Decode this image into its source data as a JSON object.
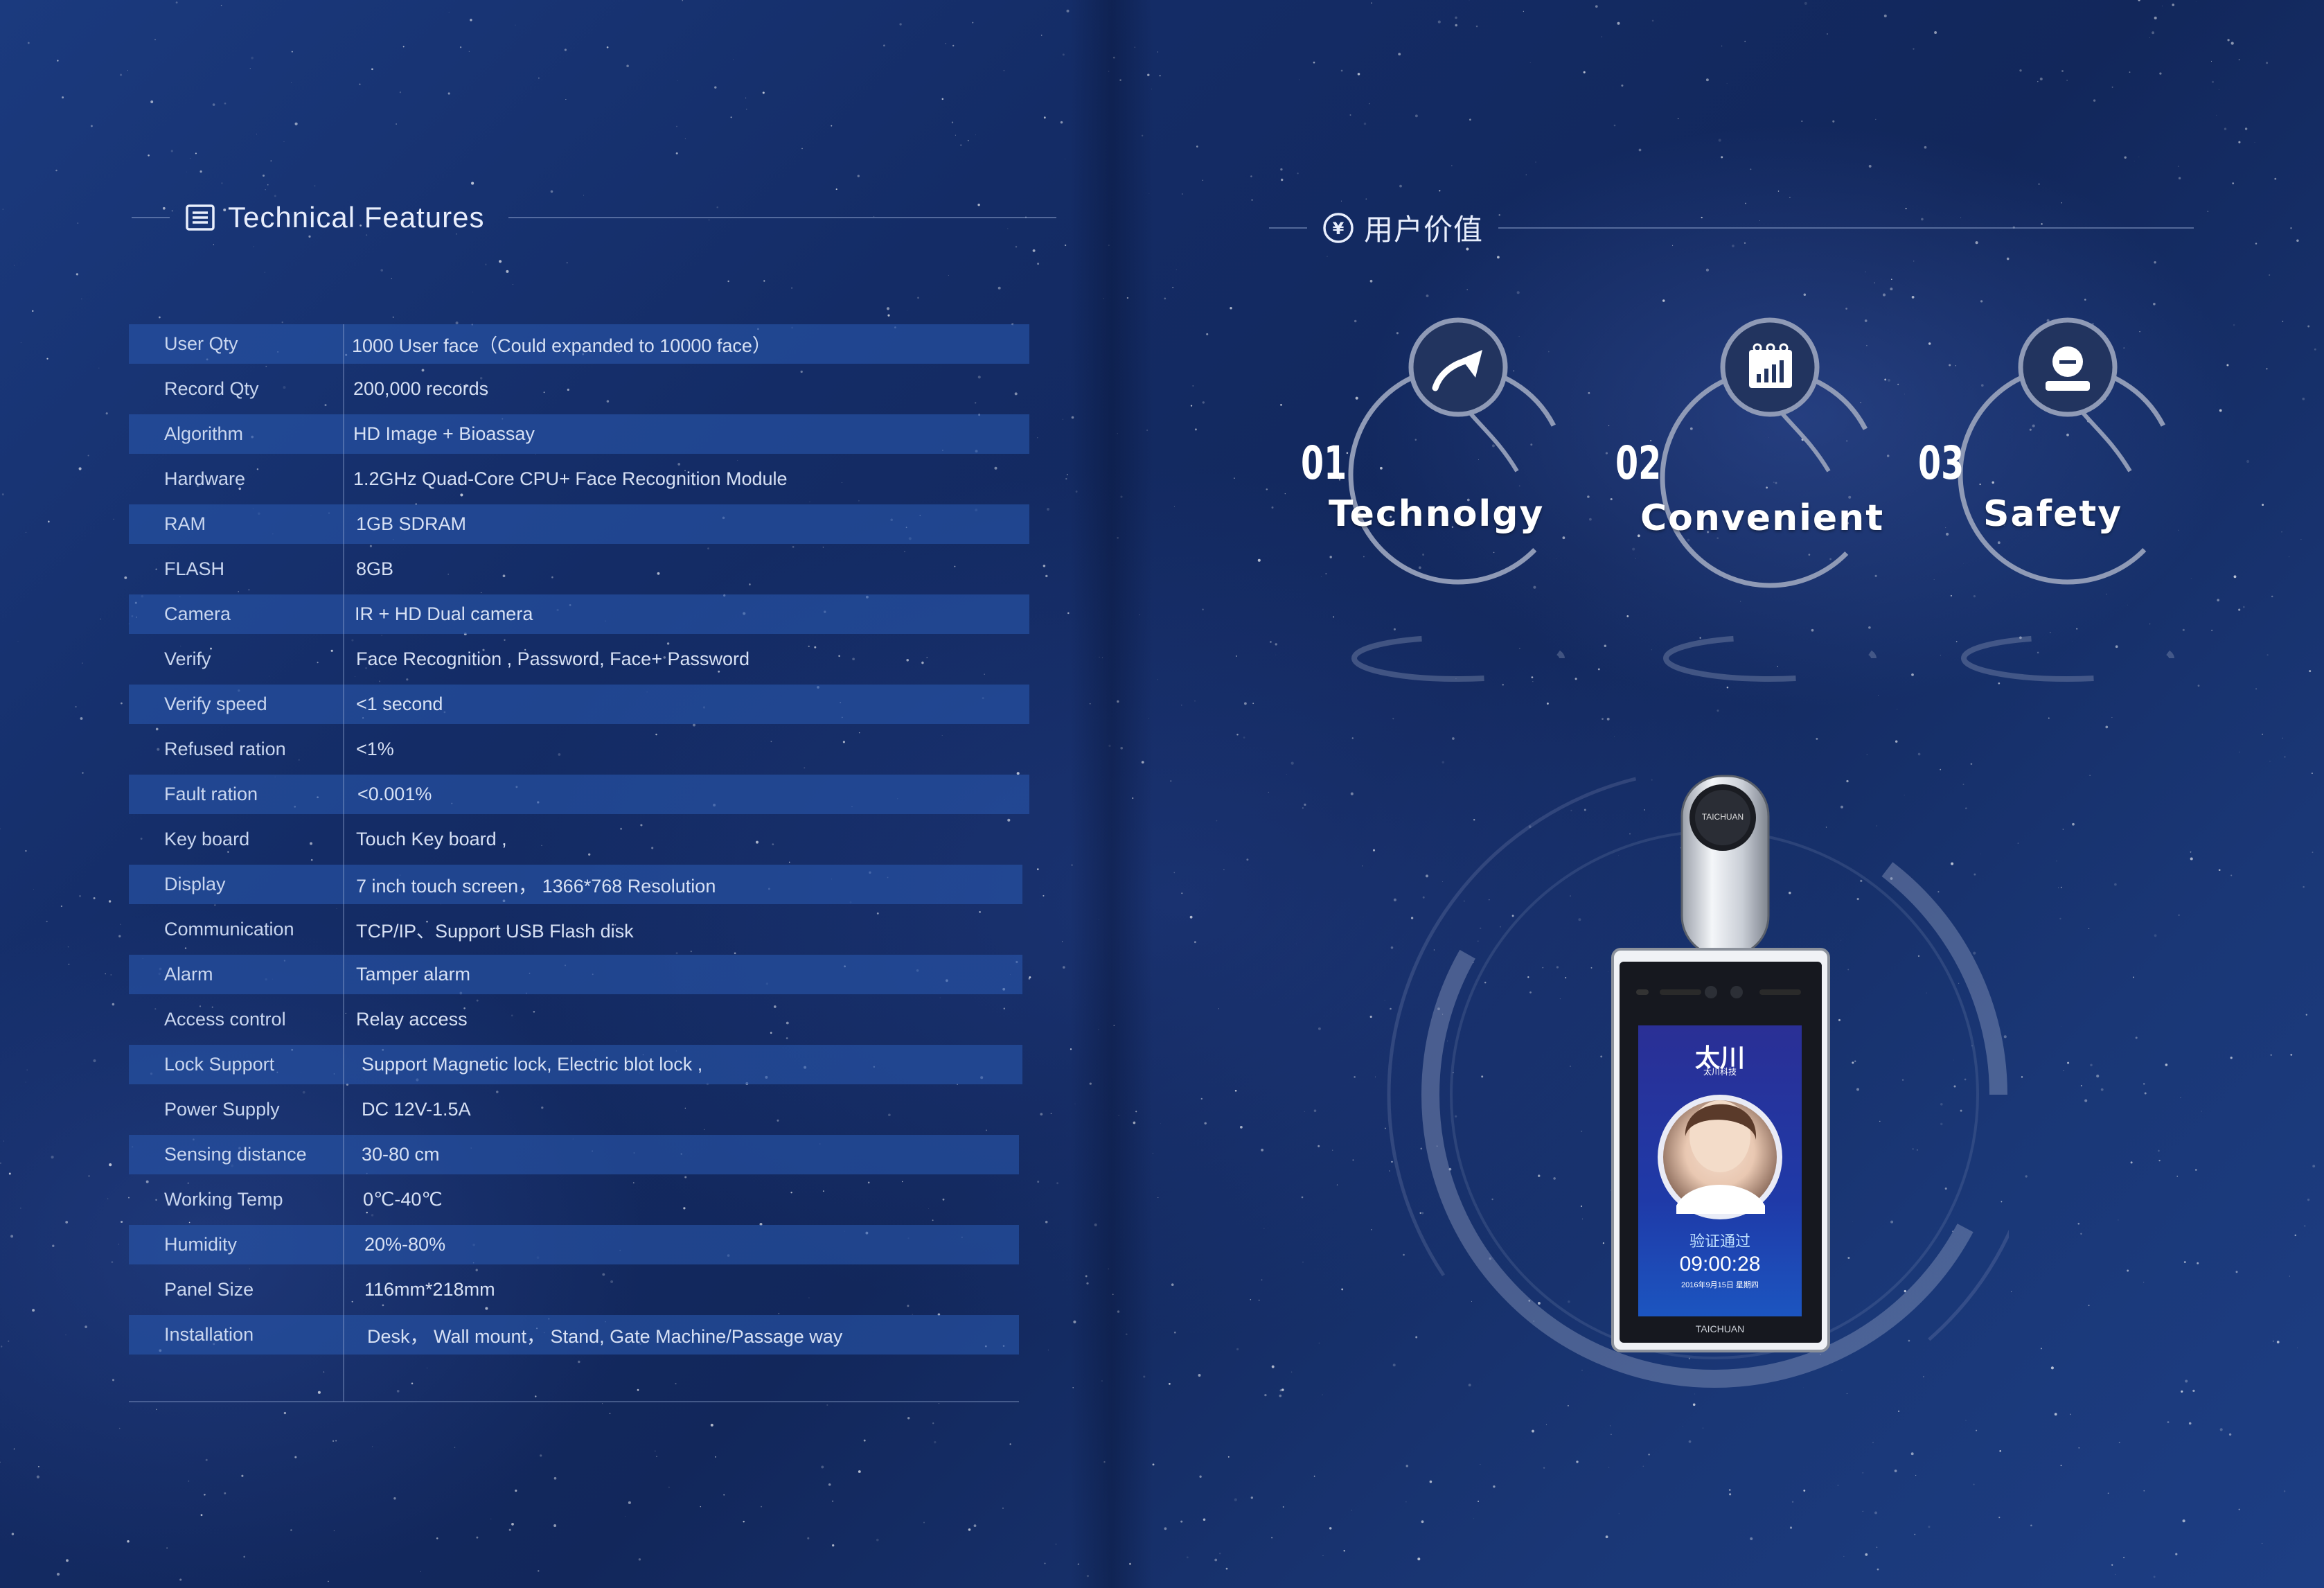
{
  "left": {
    "heading": "Technical Features",
    "heading_icon": "list-icon",
    "specs": [
      {
        "label": "User Qty",
        "value": "1000 User face（Could expanded to 10000 face）"
      },
      {
        "label": "Record Qty",
        "value": "200,000 records"
      },
      {
        "label": "Algorithm",
        "value": "HD Image + Bioassay"
      },
      {
        "label": "Hardware",
        "value": "1.2GHz Quad-Core CPU+ Face Recognition Module"
      },
      {
        "label": "RAM",
        "value": "1GB SDRAM"
      },
      {
        "label": "FLASH",
        "value": "8GB"
      },
      {
        "label": "Camera",
        "value": "IR + HD Dual camera"
      },
      {
        "label": "Verify",
        "value": "Face Recognition , Password,  Face+ Password"
      },
      {
        "label": "Verify speed",
        "value": "<1 second"
      },
      {
        "label": "Refused ration",
        "value": "<1%"
      },
      {
        "label": "Fault ration",
        "value": "<0.001%"
      },
      {
        "label": "Key board",
        "value": "Touch Key board ,"
      },
      {
        "label": "Display",
        "value": "7 inch touch screen， 1366*768 Resolution"
      },
      {
        "label": "Communication",
        "value": "TCP/IP、Support USB Flash disk"
      },
      {
        "label": "Alarm",
        "value": "Tamper alarm"
      },
      {
        "label": "Access control",
        "value": "Relay access"
      },
      {
        "label": "Lock Support",
        "value": "Support Magnetic lock, Electric blot lock ,"
      },
      {
        "label": "Power Supply",
        "value": "DC 12V-1.5A"
      },
      {
        "label": "Sensing distance",
        "value": "30-80 cm"
      },
      {
        "label": "Working Temp",
        "value": "0℃-40℃"
      },
      {
        "label": "Humidity",
        "value": "20%-80%"
      },
      {
        "label": "Panel Size",
        "value": "116mm*218mm"
      },
      {
        "label": "Installation",
        "value": "Desk， Wall mount， Stand, Gate Machine/Passage way"
      }
    ]
  },
  "right": {
    "heading": "用户价值",
    "heading_icon": "yen-circle-icon",
    "values": [
      {
        "num": "01",
        "label": "Technolgy",
        "icon": "arrow-up-right-icon"
      },
      {
        "num": "02",
        "label": "Convenient",
        "icon": "calendar-chart-icon"
      },
      {
        "num": "03",
        "label": "Safety",
        "icon": "user-icon"
      }
    ],
    "device": {
      "camera_brand": "TAICHUAN",
      "bottom_brand": "TAICHUAN",
      "screen_logo": "太川",
      "screen_logo_sub": "太川科技",
      "status": "验证通过",
      "time": "09:00:28",
      "date": "2016年9月15日 星期四"
    }
  },
  "colors": {
    "background": "#142c66",
    "row_band": "#2855aa",
    "text": "#d6e0f4",
    "accent_ring": "#9aa6c4"
  }
}
